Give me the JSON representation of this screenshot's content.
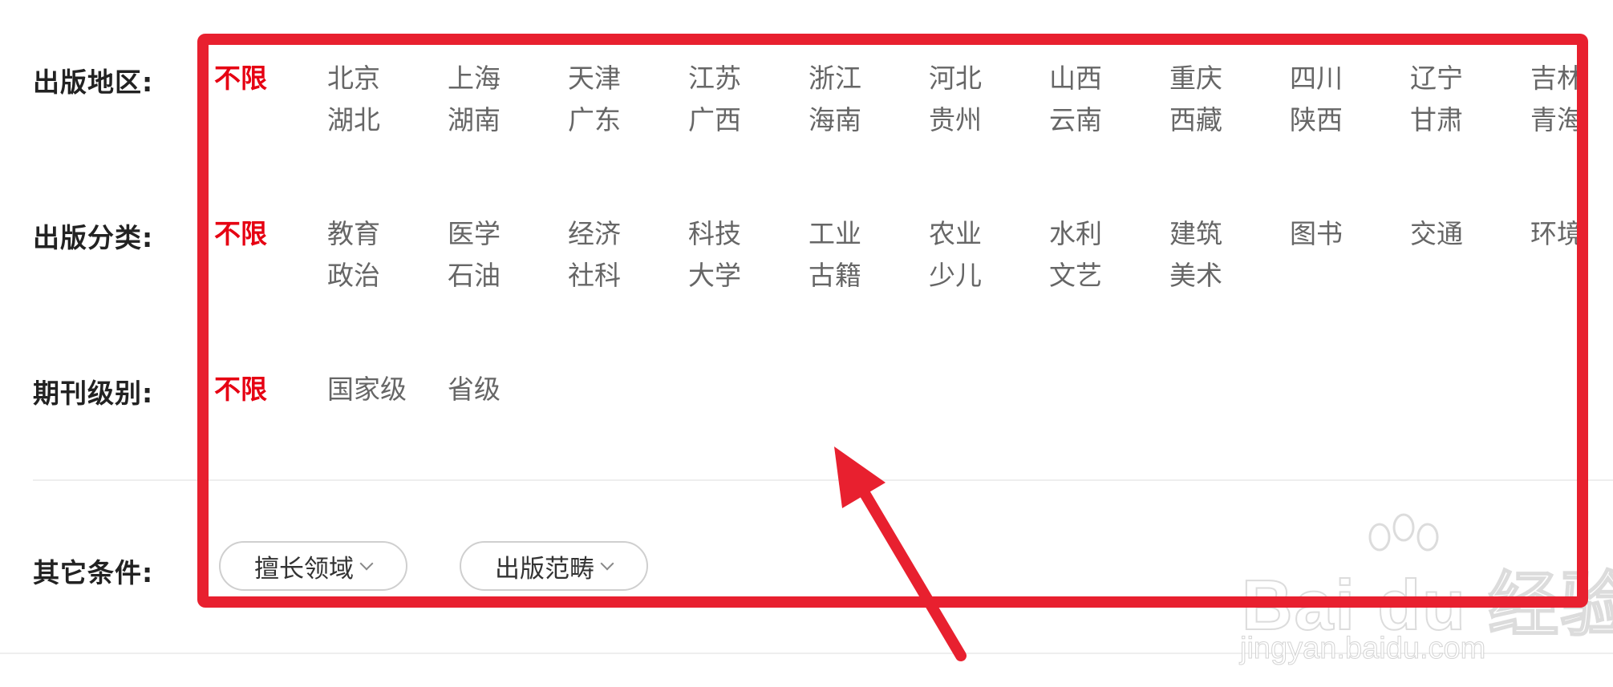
{
  "rows": {
    "region": {
      "label": "出版地区:",
      "options": [
        "不限",
        "北京",
        "上海",
        "天津",
        "江苏",
        "浙江",
        "河北",
        "山西",
        "重庆",
        "四川",
        "辽宁",
        "吉林",
        "湖北",
        "湖南",
        "广东",
        "广西",
        "海南",
        "贵州",
        "云南",
        "西藏",
        "陕西",
        "甘肃",
        "青海"
      ],
      "active_index": 0
    },
    "category": {
      "label": "出版分类:",
      "options": [
        "不限",
        "教育",
        "医学",
        "经济",
        "科技",
        "工业",
        "农业",
        "水利",
        "建筑",
        "图书",
        "交通",
        "环境",
        "政治",
        "石油",
        "社科",
        "大学",
        "古籍",
        "少儿",
        "文艺",
        "美术"
      ],
      "active_index": 0
    },
    "level": {
      "label": "期刊级别:",
      "options": [
        "不限",
        "国家级",
        "省级"
      ],
      "active_index": 0
    },
    "other": {
      "label": "其它条件:",
      "dropdowns": [
        "擅长领域",
        "出版范畴"
      ]
    }
  },
  "watermark": {
    "logo": "Bai du 经验",
    "url": "jingyan.baidu.com"
  },
  "colors": {
    "active": "#e60012",
    "annotation": "#e8202f",
    "option": "#666666"
  }
}
